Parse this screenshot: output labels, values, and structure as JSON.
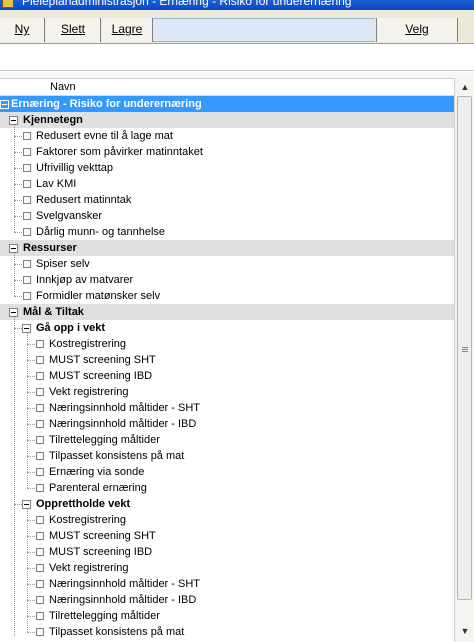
{
  "window": {
    "title": "Pleieplanadministrasjon - Ernæring - Risiko for underernæring"
  },
  "toolbar": {
    "new_label": "Ny",
    "delete_label": "Slett",
    "save_label": "Lagre",
    "select_label": "Velg"
  },
  "tree": {
    "column_header": "Navn",
    "root": "Ernæring - Risiko for underernæring",
    "groups": [
      {
        "label": "Kjennetegn",
        "items": [
          "Redusert evne til å lage mat",
          "Faktorer som påvirker matinntaket",
          "Ufrivillig vekttap",
          "Lav KMI",
          "Redusert matinntak",
          "Svelgvansker",
          "Dårlig munn- og tannhelse"
        ]
      },
      {
        "label": "Ressurser",
        "items": [
          "Spiser selv",
          "Innkjøp av matvarer",
          "Formidler matønsker selv"
        ]
      },
      {
        "label": "Mål & Tiltak",
        "subgroups": [
          {
            "label": "Gå opp i vekt",
            "items": [
              "Kostregistrering",
              "MUST screening SHT",
              "MUST screening IBD",
              "Vekt registrering",
              "Næringsinnhold måltider - SHT",
              "Næringsinnhold måltider - IBD",
              "Tilrettelegging måltider",
              "Tilpasset konsistens på mat",
              "Ernæring via sonde",
              "Parenteral ernæring"
            ]
          },
          {
            "label": "Opprettholde vekt",
            "items": [
              "Kostregistrering",
              "MUST screening SHT",
              "MUST screening IBD",
              "Vekt registrering",
              "Næringsinnhold måltider - SHT",
              "Næringsinnhold måltider - IBD",
              "Tilrettelegging måltider",
              "Tilpasset konsistens på mat"
            ]
          }
        ]
      }
    ]
  }
}
